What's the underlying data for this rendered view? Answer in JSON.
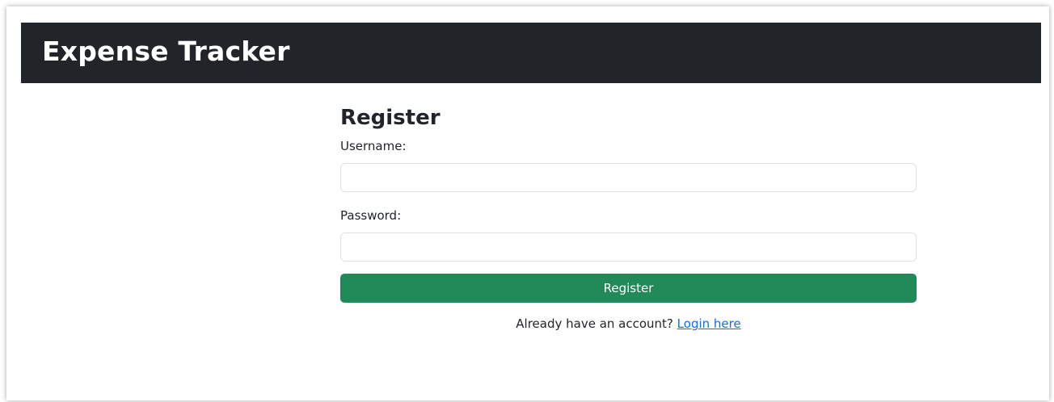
{
  "app": {
    "brand": "Expense Tracker"
  },
  "register_form": {
    "title": "Register",
    "username_label": "Username:",
    "username_value": "",
    "password_label": "Password:",
    "password_value": "",
    "submit_label": "Register",
    "login_prompt": "Already have an account?",
    "login_link": "Login here"
  },
  "colors": {
    "navbar_bg": "#212529",
    "brand_text": "#ffffff",
    "button_bg": "#218a58",
    "link": "#0d6efd"
  }
}
